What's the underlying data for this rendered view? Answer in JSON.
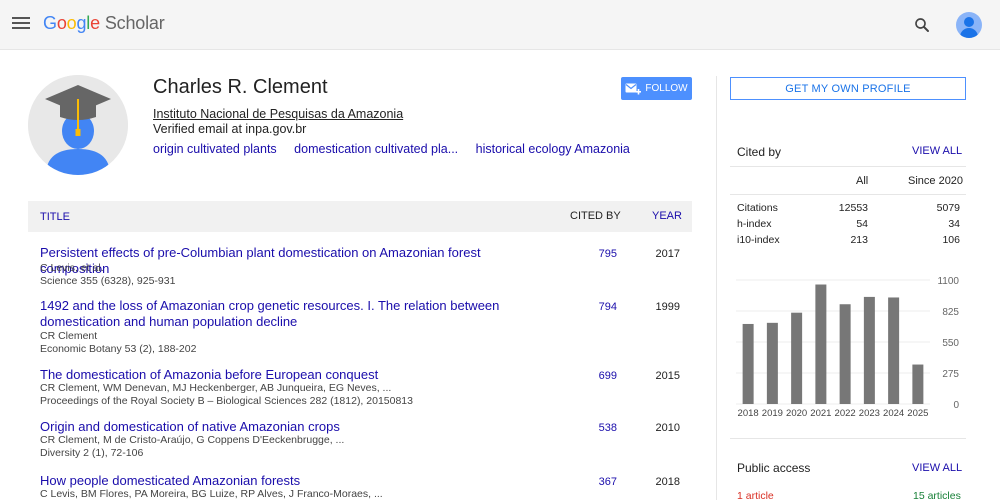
{
  "header": {
    "logo_letters": [
      "G",
      "o",
      "o",
      "g",
      "l",
      "e"
    ],
    "logo_product": "Scholar",
    "icons": {
      "menu": "menu-icon",
      "search": "search-icon",
      "account": "account-avatar"
    }
  },
  "profile": {
    "name": "Charles R. Clement",
    "affiliation": "Instituto Nacional de Pesquisas da Amazonia",
    "email": "Verified email at inpa.gov.br",
    "interests": [
      "origin cultivated plants",
      "domestication cultivated pla...",
      "historical ecology Amazonia"
    ],
    "follow_label": "FOLLOW"
  },
  "table": {
    "col_title": "TITLE",
    "col_cited": "CITED BY",
    "col_year": "YEAR",
    "rows": [
      {
        "title_lines": [
          "Persistent effects of pre-Columbian plant domestication on Amazonian forest composition"
        ],
        "authors": "C Levis, et al.",
        "publication": "Science 355 (6328), 925-931",
        "cited": "795",
        "year": "2017"
      },
      {
        "title_lines": [
          "1492 and the loss of Amazonian crop genetic resources. I. The relation between",
          "domestication and human population decline"
        ],
        "authors": "CR Clement",
        "publication": "Economic Botany 53 (2), 188-202",
        "cited": "794",
        "year": "1999"
      },
      {
        "title_lines": [
          "The domestication of Amazonia before European conquest"
        ],
        "authors": "CR Clement, WM Denevan, MJ Heckenberger, AB Junqueira, EG Neves, ...",
        "publication": "Proceedings of the Royal Society B – Biological Sciences 282 (1812), 20150813",
        "cited": "699",
        "year": "2015"
      },
      {
        "title_lines": [
          "Origin and domestication of native Amazonian crops"
        ],
        "authors": "CR Clement, M de Cristo-Araújo, G Coppens D'Eeckenbrugge, ...",
        "publication": "Diversity 2 (1), 72-106",
        "cited": "538",
        "year": "2010"
      },
      {
        "title_lines": [
          "How people domesticated Amazonian forests"
        ],
        "authors": "C Levis, BM Flores, PA Moreira, BG Luize, RP Alves, J Franco-Moraes, ...",
        "publication": "",
        "cited": "367",
        "year": "2018"
      }
    ]
  },
  "sidebar": {
    "own_profile_label": "GET MY OWN PROFILE",
    "cited_by_title": "Cited by",
    "view_all_label": "VIEW ALL",
    "stats_header_all": "All",
    "stats_header_since": "Since 2020",
    "stats": [
      {
        "label": "Citations",
        "all": "12553",
        "since": "5079"
      },
      {
        "label": "h-index",
        "all": "54",
        "since": "34"
      },
      {
        "label": "i10-index",
        "all": "213",
        "since": "106"
      }
    ],
    "public_access_title": "Public access",
    "public_access_view_all": "VIEW ALL",
    "public_unavailable": "1 article",
    "public_available": "15 articles"
  },
  "chart_data": {
    "type": "bar",
    "categories": [
      "2018",
      "2019",
      "2020",
      "2021",
      "2022",
      "2023",
      "2024",
      "2025"
    ],
    "values": [
      710,
      720,
      810,
      1060,
      885,
      950,
      945,
      350
    ],
    "ylim": [
      0,
      1100
    ],
    "yticks": [
      "1100",
      "825",
      "550",
      "275",
      "0"
    ],
    "bar_color": "#777777"
  }
}
